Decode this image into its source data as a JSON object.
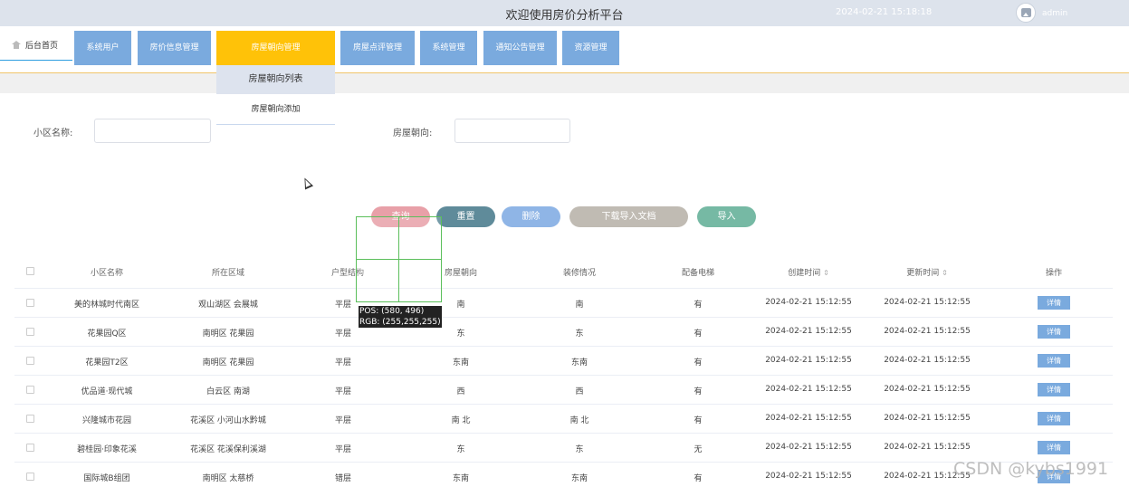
{
  "header": {
    "title": "欢迎使用房价分析平台",
    "datetime": "2024-02-21 15:18:18",
    "username": "admin"
  },
  "nav": {
    "home_label": "后台首页",
    "items": [
      {
        "label": "系统用户"
      },
      {
        "label": "房价信息管理"
      },
      {
        "label": "房屋朝向管理"
      },
      {
        "label": "房屋点评管理"
      },
      {
        "label": "系统管理"
      },
      {
        "label": "通知公告管理"
      },
      {
        "label": "资源管理"
      }
    ],
    "active_item": "房屋朝向管理",
    "dropdown": [
      "房屋朝向列表",
      "房屋朝向添加"
    ]
  },
  "search": {
    "community_label": "小区名称:",
    "community_value": "",
    "orientation_label": "房屋朝向:",
    "orientation_value": ""
  },
  "actions": {
    "query": "查询",
    "reset": "重置",
    "delete": "删除",
    "download": "下载导入文档",
    "import": "导入"
  },
  "table": {
    "columns": [
      "小区名称",
      "所在区域",
      "户型结构",
      "房屋朝向",
      "装修情况",
      "配备电梯",
      "创建时间",
      "更新时间",
      "操作"
    ],
    "sortable_columns": [
      "创建时间",
      "更新时间"
    ],
    "detail_label": "详情",
    "rows": [
      {
        "name": "美的林城时代南区",
        "area": "观山湖区 会展城",
        "layout": "平层",
        "orientation": "南",
        "decor": "南",
        "elevator": "有",
        "created": "2024-02-21 15:12:55",
        "updated": "2024-02-21 15:12:55"
      },
      {
        "name": "花果园Q区",
        "area": "南明区 花果园",
        "layout": "平层",
        "orientation": "东",
        "decor": "东",
        "elevator": "有",
        "created": "2024-02-21 15:12:55",
        "updated": "2024-02-21 15:12:55"
      },
      {
        "name": "花果园T2区",
        "area": "南明区 花果园",
        "layout": "平层",
        "orientation": "东南",
        "decor": "东南",
        "elevator": "有",
        "created": "2024-02-21 15:12:55",
        "updated": "2024-02-21 15:12:55"
      },
      {
        "name": "优品道·现代城",
        "area": "白云区 南湖",
        "layout": "平层",
        "orientation": "西",
        "decor": "西",
        "elevator": "有",
        "created": "2024-02-21 15:12:55",
        "updated": "2024-02-21 15:12:55"
      },
      {
        "name": "兴隆城市花园",
        "area": "花溪区 小河山水黔城",
        "layout": "平层",
        "orientation": "南 北",
        "decor": "南 北",
        "elevator": "有",
        "created": "2024-02-21 15:12:55",
        "updated": "2024-02-21 15:12:55"
      },
      {
        "name": "碧桂园·印象花溪",
        "area": "花溪区 花溪保利溪湖",
        "layout": "平层",
        "orientation": "东",
        "decor": "东",
        "elevator": "无",
        "created": "2024-02-21 15:12:55",
        "updated": "2024-02-21 15:12:55"
      },
      {
        "name": "国际城B组团",
        "area": "南明区 太慈桥",
        "layout": "错层",
        "orientation": "东南",
        "decor": "东南",
        "elevator": "有",
        "created": "2024-02-21 15:12:55",
        "updated": "2024-02-21 15:12:55"
      }
    ]
  },
  "overlay": {
    "pos_text": "POS: (580, 496)",
    "rgb_text": "RGB: (255,255,255)"
  },
  "watermark": "CSDN @kybs1991",
  "colors": {
    "nav_button": "#7aaade",
    "nav_active": "#ffc208",
    "query": "#e8a0a8",
    "reset": "#5f8b9a",
    "delete": "#8fb5e6",
    "download": "#c0bbb3",
    "import": "#76b9a4"
  },
  "icons": [
    "home-icon",
    "avatar-icon",
    "sort-icon",
    "mouse-cursor-icon"
  ]
}
